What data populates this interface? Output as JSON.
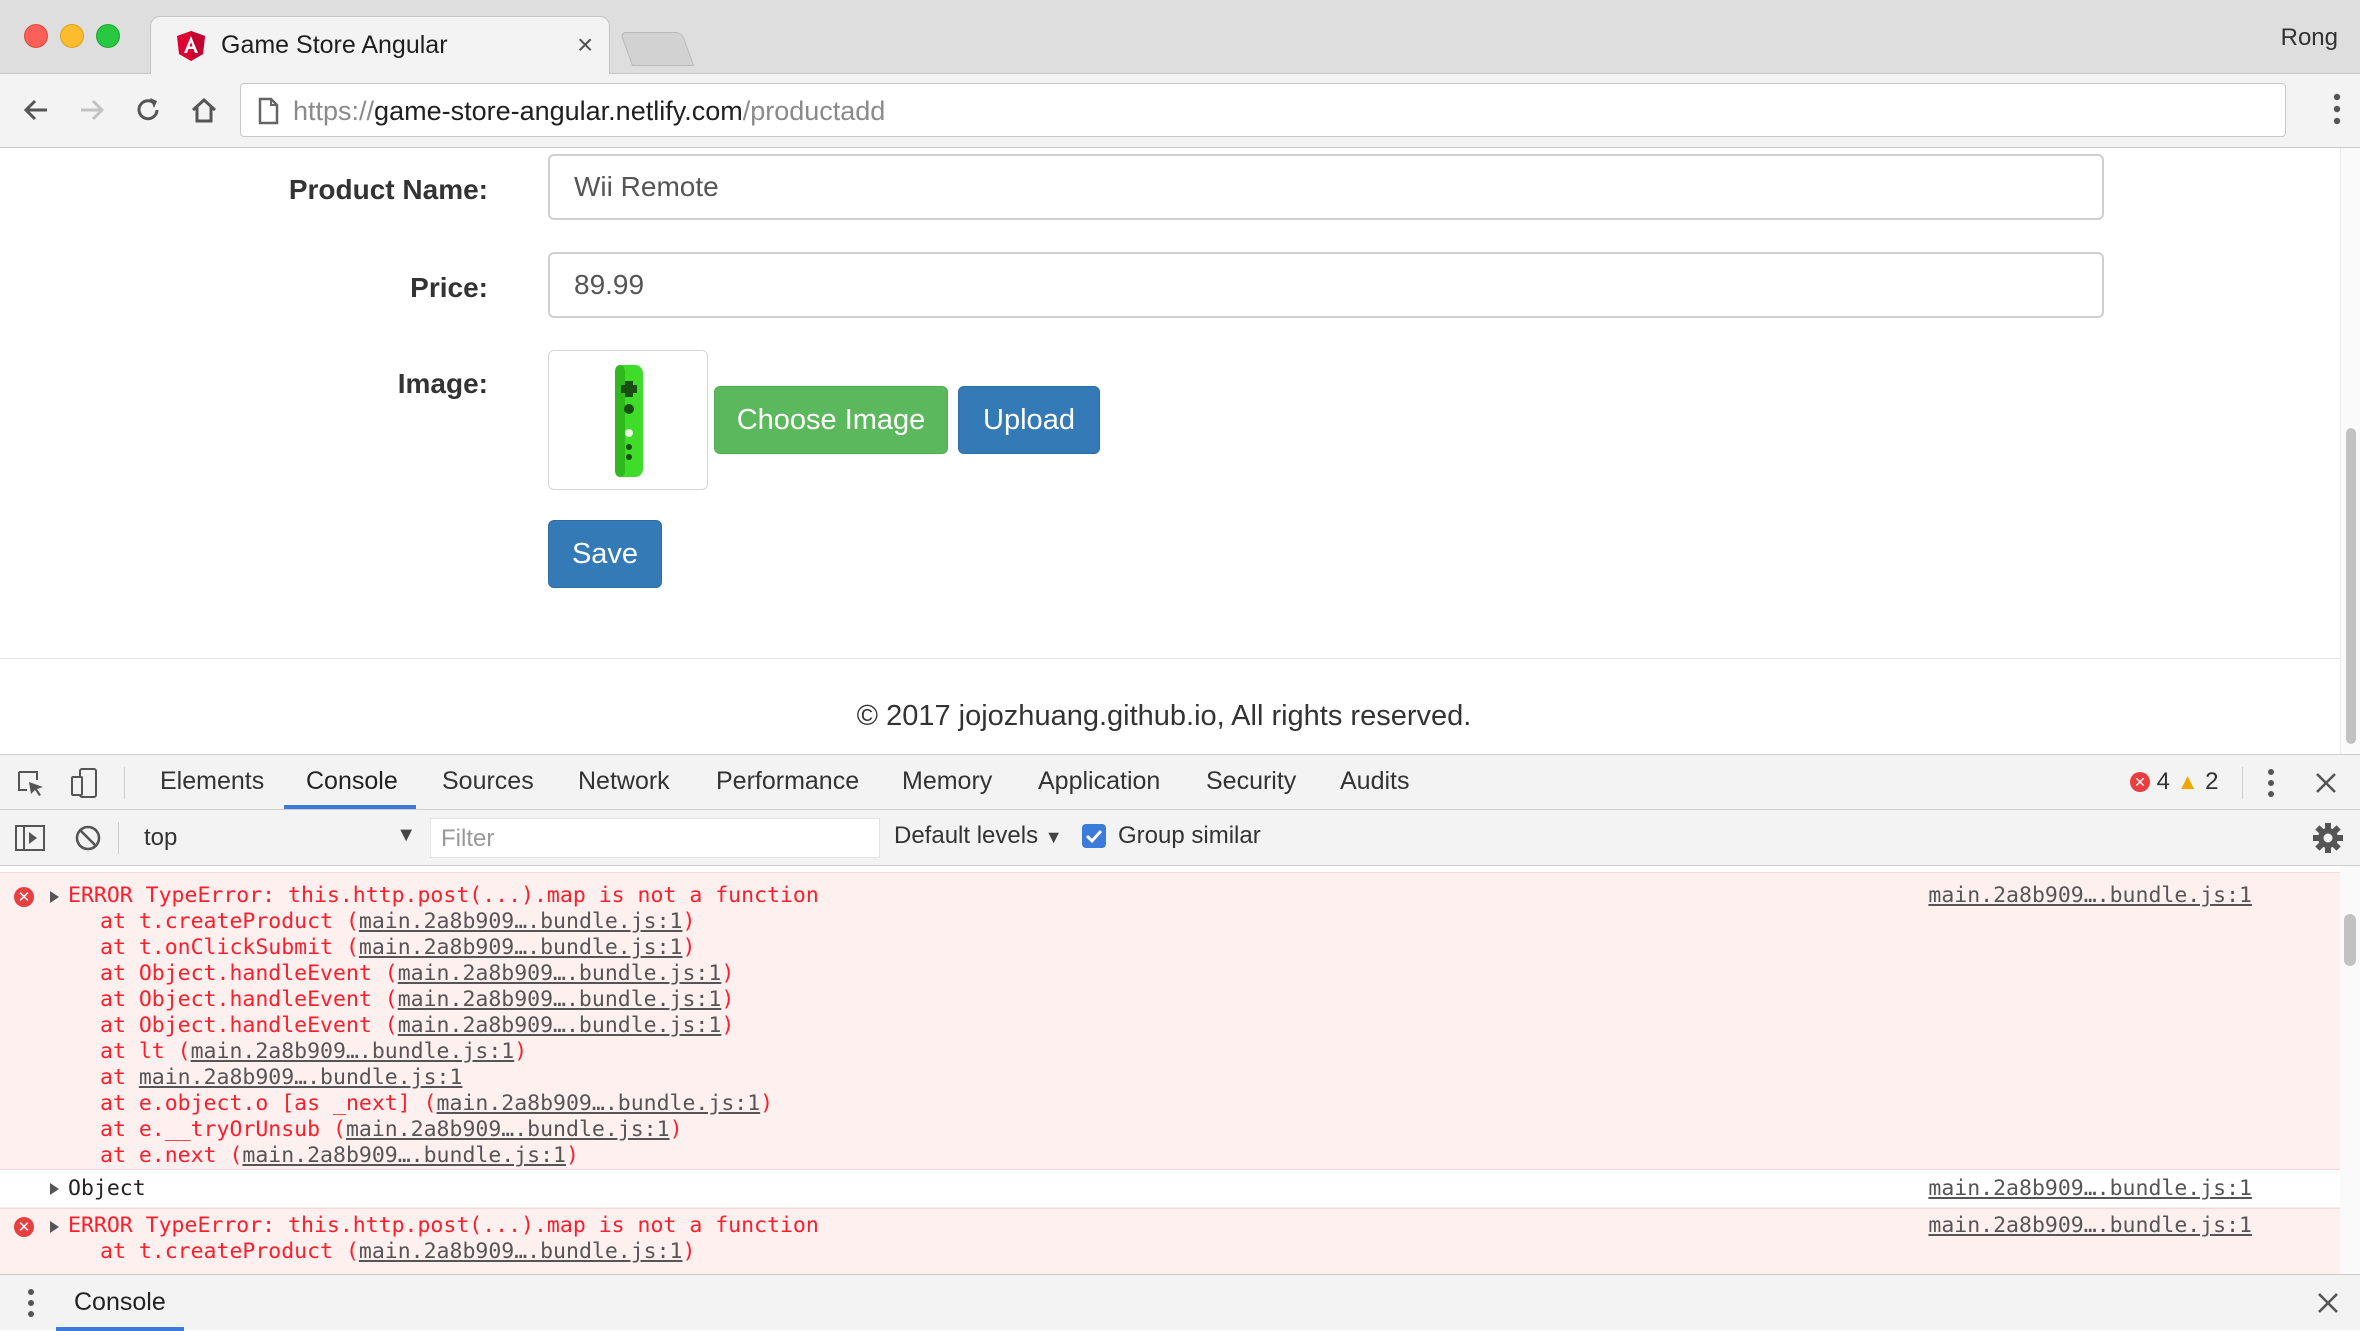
{
  "browser": {
    "tab_title": "Game Store Angular",
    "tab_close": "×",
    "profile_name": "Rong",
    "url_scheme": "https://",
    "url_host": "game-store-angular.netlify.com",
    "url_path": "/productadd"
  },
  "form": {
    "name_label": "Product Name:",
    "name_value": "Wii Remote",
    "price_label": "Price:",
    "price_value": "89.99",
    "image_label": "Image:",
    "choose_button": "Choose Image",
    "upload_button": "Upload",
    "save_button": "Save"
  },
  "footer": {
    "text": "© 2017 jojozhuang.github.io, All rights reserved."
  },
  "devtools": {
    "tabs": [
      "Elements",
      "Console",
      "Sources",
      "Network",
      "Performance",
      "Memory",
      "Application",
      "Security",
      "Audits"
    ],
    "active_tab": "Console",
    "error_count": "4",
    "warning_count": "2",
    "context": "top",
    "filter_placeholder": "Filter",
    "levels": "Default levels",
    "group_similar": "Group similar",
    "drawer_tab": "Console",
    "colors": {
      "error_text": "#fd1e2b",
      "error_bg": "#fff0f0",
      "accent": "#3b7bd9"
    }
  },
  "console": {
    "source": "main.2a8b909….bundle.js:1",
    "error1": {
      "message": "ERROR TypeError: this.http.post(...).map is not a function",
      "stack": [
        "at t.createProduct (main.2a8b909….bundle.js:1)",
        "at t.onClickSubmit (main.2a8b909….bundle.js:1)",
        "at Object.handleEvent (main.2a8b909….bundle.js:1)",
        "at Object.handleEvent (main.2a8b909….bundle.js:1)",
        "at Object.handleEvent (main.2a8b909….bundle.js:1)",
        "at lt (main.2a8b909….bundle.js:1)",
        "at main.2a8b909….bundle.js:1",
        "at e.object.o [as _next] (main.2a8b909….bundle.js:1)",
        "at e.__tryOrUnsub (main.2a8b909….bundle.js:1)",
        "at e.next (main.2a8b909….bundle.js:1)"
      ]
    },
    "log": {
      "message": "Object"
    },
    "error2": {
      "message": "ERROR TypeError: this.http.post(...).map is not a function",
      "stack": [
        "at t.createProduct (main.2a8b909….bundle.js:1)"
      ]
    }
  }
}
